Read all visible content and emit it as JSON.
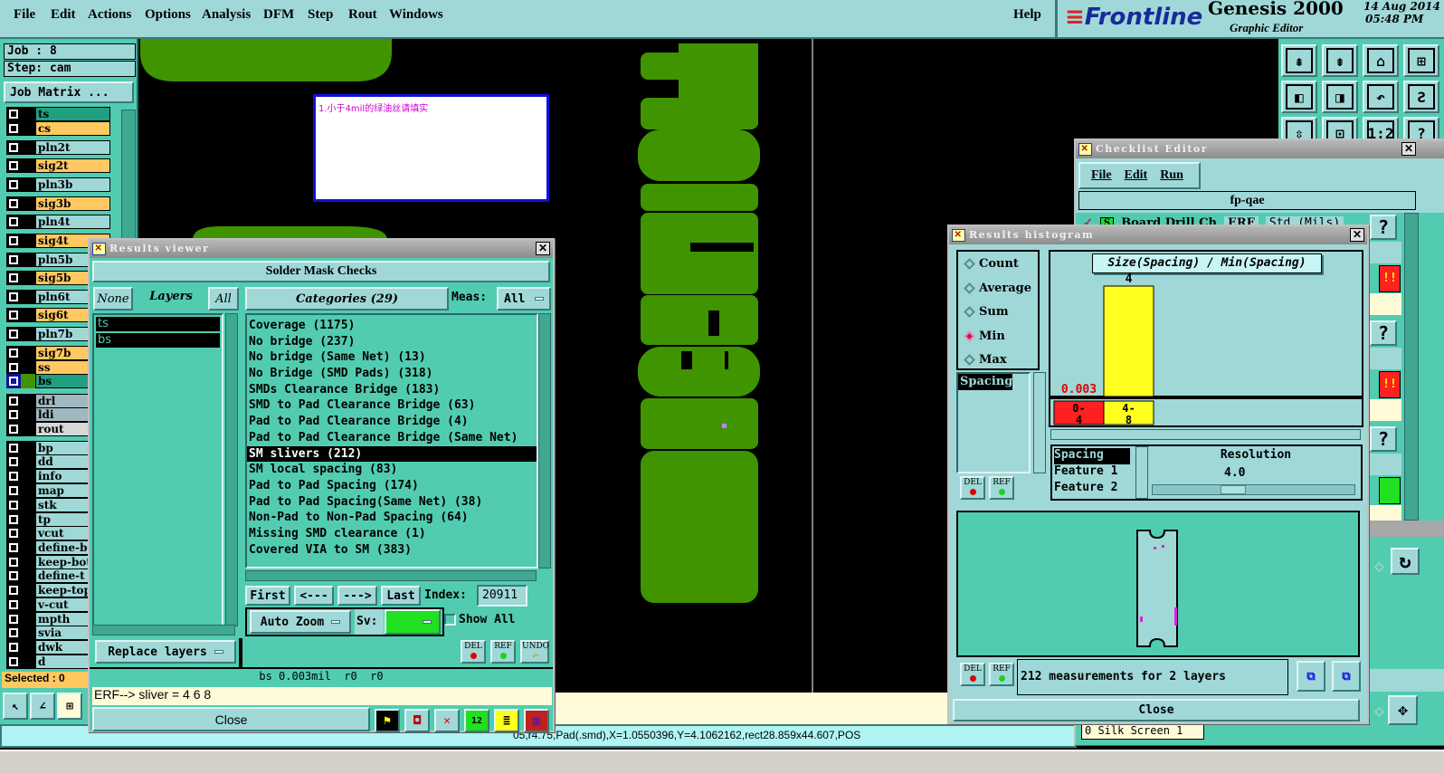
{
  "menu": {
    "items": [
      "File",
      "Edit",
      "Actions",
      "Options",
      "Analysis",
      "DFM",
      "Step",
      "Rout",
      "Windows"
    ],
    "help": "Help"
  },
  "header": {
    "brand": "Frontline",
    "product": "Genesis 2000",
    "subtitle": "Graphic Editor",
    "date": "14 Aug 2014",
    "time": "05:48 PM"
  },
  "left_panel": {
    "job": "Job : 8",
    "step": "Step: cam",
    "job_matrix": "Job Matrix ...",
    "selected": "Selected : 0",
    "layers": [
      {
        "name": "ts",
        "type": "mask"
      },
      {
        "name": "cs",
        "type": "signal"
      },
      {
        "name": "pln2t",
        "type": "plane"
      },
      {
        "name": "sig2t",
        "type": "signal"
      },
      {
        "name": "pln3b",
        "type": "plane"
      },
      {
        "name": "sig3b",
        "type": "signal"
      },
      {
        "name": "pln4t",
        "type": "plane"
      },
      {
        "name": "sig4t",
        "type": "signal"
      },
      {
        "name": "pln5b",
        "type": "plane"
      },
      {
        "name": "sig5b",
        "type": "signal"
      },
      {
        "name": "pln6t",
        "type": "plane"
      },
      {
        "name": "sig6t",
        "type": "signal"
      },
      {
        "name": "pln7b",
        "type": "plane"
      },
      {
        "name": "sig7b",
        "type": "signal"
      },
      {
        "name": "ss",
        "type": "signal"
      },
      {
        "name": "bs",
        "type": "mask",
        "active": true
      },
      {
        "name": "drl",
        "type": "drill"
      },
      {
        "name": "ldi",
        "type": "drill"
      },
      {
        "name": "rout",
        "type": "rout"
      },
      {
        "name": "bp",
        "type": "misc"
      },
      {
        "name": "dd",
        "type": "misc"
      },
      {
        "name": "info",
        "type": "misc"
      },
      {
        "name": "map",
        "type": "misc"
      },
      {
        "name": "stk",
        "type": "misc"
      },
      {
        "name": "tp",
        "type": "misc"
      },
      {
        "name": "vcut",
        "type": "misc"
      },
      {
        "name": "define-b",
        "type": "misc"
      },
      {
        "name": "keep-bot",
        "type": "misc"
      },
      {
        "name": "define-t",
        "type": "misc"
      },
      {
        "name": "keep-top",
        "type": "misc"
      },
      {
        "name": "v-cut",
        "type": "misc"
      },
      {
        "name": "mpth",
        "type": "misc"
      },
      {
        "name": "svia",
        "type": "misc"
      },
      {
        "name": "dwk",
        "type": "misc"
      },
      {
        "name": "d",
        "type": "misc"
      }
    ],
    "layer_colors": {
      "mask": "#20a080",
      "signal": "#ffc860",
      "plane": "#a0d8d8",
      "drill": "#a0b8c0",
      "rout": "#d8d8d8",
      "misc": "#a0d8d8"
    }
  },
  "canvas": {
    "note": "1.小于4mil的绿油丝请填实",
    "feature_color": "#3f9400",
    "note_color": "#d000d0"
  },
  "status_bar": {
    "text": "05,r4.75,Pad(.smd),X=1.0550396,Y=4.1062162,rect28.859x44.607,POS"
  },
  "results_viewer": {
    "title": "Results viewer",
    "check_set": "Solder Mask Checks",
    "none": "None",
    "layers_label": "Layers",
    "all": "All",
    "layers": [
      "ts",
      "bs"
    ],
    "categories_label": "Categories (29)",
    "meas_label": "Meas:",
    "meas_value": "All",
    "categories": [
      "Coverage (1175)",
      "No bridge (237)",
      "No bridge (Same Net) (13)",
      "No Bridge (SMD Pads) (318)",
      "SMDs Clearance Bridge (183)",
      "SMD to Pad Clearance Bridge (63)",
      "Pad to Pad Clearance Bridge (4)",
      "Pad to Pad Clearance Bridge (Same Net)",
      "SM slivers (212)",
      "SM local spacing (83)",
      "Pad to Pad Spacing (174)",
      "Pad to Pad Spacing(Same Net) (38)",
      "Non-Pad to Non-Pad Spacing (64)",
      "Missing SMD clearance (1)",
      "Covered VIA to SM (383)"
    ],
    "selected_category": "SM slivers (212)",
    "nav": {
      "first": "First",
      "prev": "<---",
      "next": "--->",
      "last": "Last",
      "index_label": "Index:",
      "index_value": "20911"
    },
    "auto_zoom": "Auto Zoom",
    "sv_label": "Sv:",
    "show_all": "Show All",
    "replace_layers": "Replace layers",
    "del": "DEL",
    "ref": "REF",
    "undo": "UNDO",
    "measure": "bs 0.003mil  r0  r0",
    "erf": "ERF--> sliver = 4 6 8",
    "close": "Close"
  },
  "histogram": {
    "title": "Results histogram",
    "modes": [
      "Count",
      "Average",
      "Sum",
      "Min",
      "Max"
    ],
    "selected_mode": "Min",
    "measure_list": [
      "Spacing"
    ],
    "sort_list": [
      "Spacing",
      "Feature 1",
      "Feature 2"
    ],
    "resolution_label": "Resolution",
    "resolution_value": "4.0",
    "summary": "212 measurements for 2 layers",
    "close": "Close",
    "del": "DEL",
    "ref": "REF"
  },
  "chart_data": {
    "type": "bar",
    "title": "Size(Spacing) / Min(Spacing)",
    "categories": [
      "0-\n4",
      "4-\n8"
    ],
    "category_labels": [
      "0-4",
      "4-8"
    ],
    "values": [
      0.003,
      4
    ],
    "value_labels": [
      "0.003",
      "4"
    ],
    "colors": [
      "#ff2020",
      "#ffff20"
    ]
  },
  "checklist_editor": {
    "title": "Checklist Editor",
    "menu": [
      "File",
      "Edit",
      "Run"
    ],
    "name": "fp-qae",
    "first_row": {
      "action": "Board Drill Ch",
      "erf": "ERF",
      "units": "Std (Mils)"
    },
    "help": "?",
    "alert": "!!",
    "bottom_row": "0 Silk Screen 1",
    "status_colors": [
      "#ff2020",
      "#ff2020",
      "#20e020"
    ]
  }
}
